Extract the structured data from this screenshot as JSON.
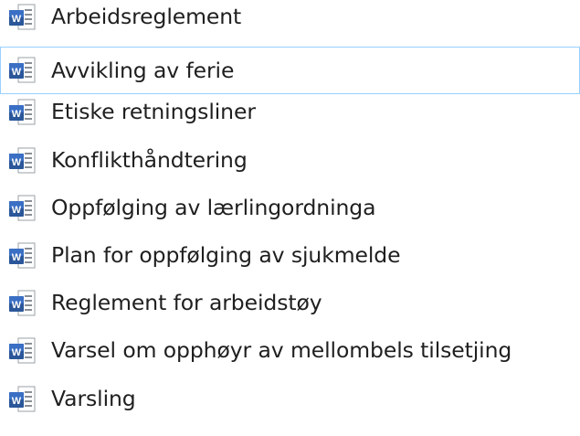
{
  "files": [
    {
      "name": "Arbeidsreglement",
      "icon": "word-document-icon"
    },
    {
      "name": "Avvikling av ferie",
      "icon": "word-document-icon",
      "hovered": true
    },
    {
      "name": "Etiske retningsliner",
      "icon": "word-document-icon"
    },
    {
      "name": "Konflikthåndtering",
      "icon": "word-document-icon"
    },
    {
      "name": "Oppfølging av lærlingordninga",
      "icon": "word-document-icon"
    },
    {
      "name": "Plan for oppfølging av sjukmelde",
      "icon": "word-document-icon"
    },
    {
      "name": "Reglement for arbeidstøy",
      "icon": "word-document-icon"
    },
    {
      "name": "Varsel om opphøyr av mellombels tilsetjing",
      "icon": "word-document-icon"
    },
    {
      "name": "Varsling",
      "icon": "word-document-icon"
    }
  ],
  "colors": {
    "hover_border": "#99d1ff",
    "word_blue": "#2b579a",
    "word_blue_light": "#41a5ee",
    "text": "#1f1f1f"
  }
}
